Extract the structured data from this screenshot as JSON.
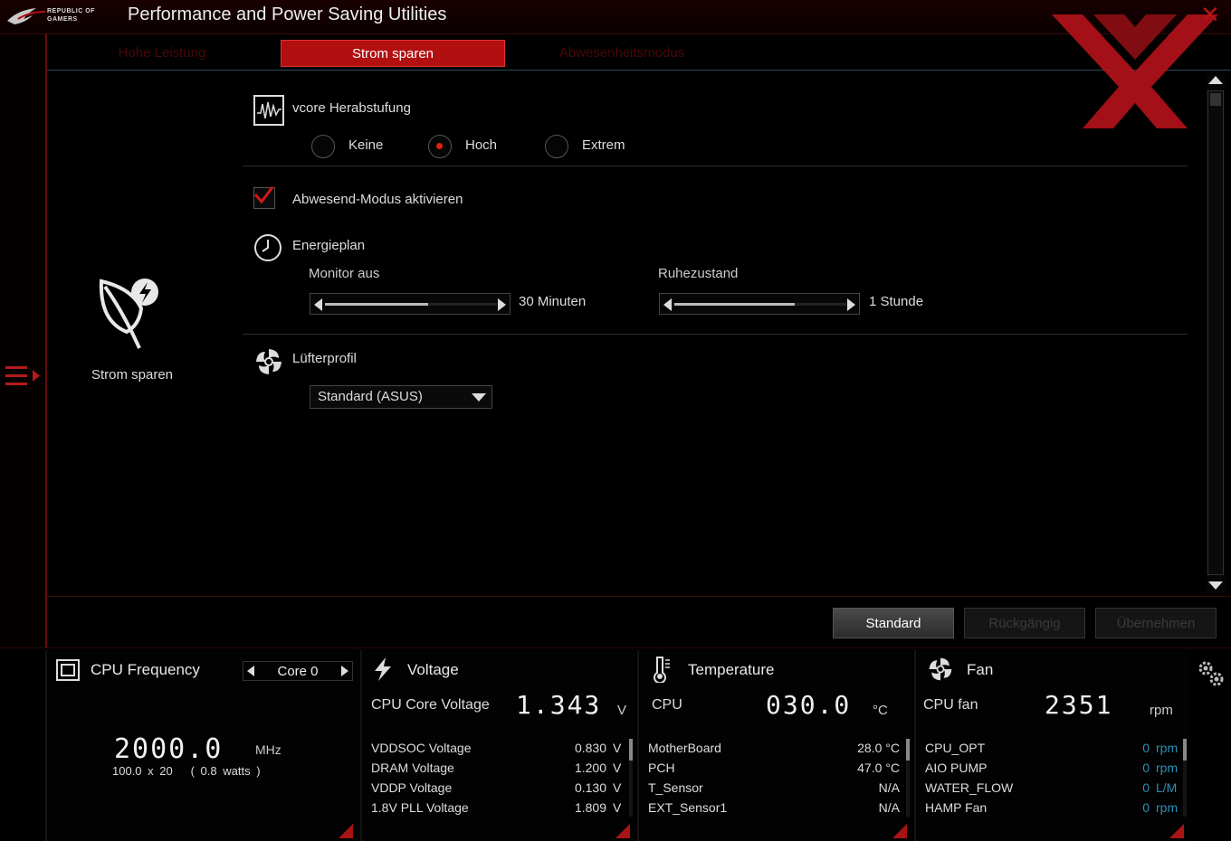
{
  "window": {
    "title": "Performance and Power Saving Utilities",
    "brand_line1": "REPUBLIC OF",
    "brand_line2": "GAMERS",
    "close_glyph": "✕"
  },
  "tabs": [
    {
      "label": "Hohe Leistung",
      "active": false
    },
    {
      "label": "Strom sparen",
      "active": true
    },
    {
      "label": "Abwesenheitsmodus",
      "active": false
    }
  ],
  "mode": {
    "label": "Strom sparen",
    "icon": "leaf-lightning-icon"
  },
  "vcore": {
    "title": "vcore Herabstufung",
    "icon": "waveform-icon",
    "options": [
      {
        "label": "Keine",
        "selected": false
      },
      {
        "label": "Hoch",
        "selected": true
      },
      {
        "label": "Extrem",
        "selected": false
      }
    ]
  },
  "away_mode": {
    "label": "Abwesend-Modus aktivieren",
    "checked": true
  },
  "energy_plan": {
    "title": "Energieplan",
    "icon": "clock-icon",
    "monitor": {
      "label": "Monitor aus",
      "value": "30 Minuten",
      "fill_fraction": 0.6
    },
    "sleep": {
      "label": "Ruhezustand",
      "value": "1 Stunde",
      "fill_fraction": 0.7
    }
  },
  "fan_profile": {
    "title": "Lüfterprofil",
    "icon": "fan-icon",
    "selected": "Standard (ASUS)"
  },
  "actions": {
    "standard": "Standard",
    "undo": "Rückgängig",
    "apply": "Übernehmen"
  },
  "cpu_frequency": {
    "title": "CPU Frequency",
    "core": "Core 0",
    "value": "2000.0",
    "unit": "MHz",
    "bclk": "100.0",
    "times": "x",
    "ratio": "20",
    "power": "( 0.8   watts )"
  },
  "voltage": {
    "title": "Voltage",
    "main_label": "CPU Core Voltage",
    "main_value": "1.343",
    "main_unit": "V",
    "rows": [
      {
        "label": "VDDSOC Voltage",
        "value": "0.830",
        "unit": "V"
      },
      {
        "label": "DRAM Voltage",
        "value": "1.200",
        "unit": "V"
      },
      {
        "label": "VDDP Voltage",
        "value": "0.130",
        "unit": "V"
      },
      {
        "label": "1.8V PLL Voltage",
        "value": "1.809",
        "unit": "V"
      }
    ]
  },
  "temperature": {
    "title": "Temperature",
    "main_label": "CPU",
    "main_value": "030.0",
    "main_unit": "°C",
    "rows": [
      {
        "label": "MotherBoard",
        "value": "28.0 °C"
      },
      {
        "label": "PCH",
        "value": "47.0 °C"
      },
      {
        "label": "T_Sensor",
        "value": "N/A"
      },
      {
        "label": "EXT_Sensor1",
        "value": "N/A"
      }
    ]
  },
  "fan": {
    "title": "Fan",
    "main_label": "CPU fan",
    "main_value": "2351",
    "main_unit": "rpm",
    "rows": [
      {
        "label": "CPU_OPT",
        "value": "0",
        "unit": "rpm"
      },
      {
        "label": "AIO PUMP",
        "value": "0",
        "unit": "rpm"
      },
      {
        "label": "WATER_FLOW",
        "value": "0",
        "unit": "L/M"
      },
      {
        "label": "HAMP Fan",
        "value": "0",
        "unit": "rpm"
      }
    ]
  },
  "colors": {
    "accent": "#b20f10",
    "fan_value": "#2c8fb7",
    "background": "#000000"
  }
}
